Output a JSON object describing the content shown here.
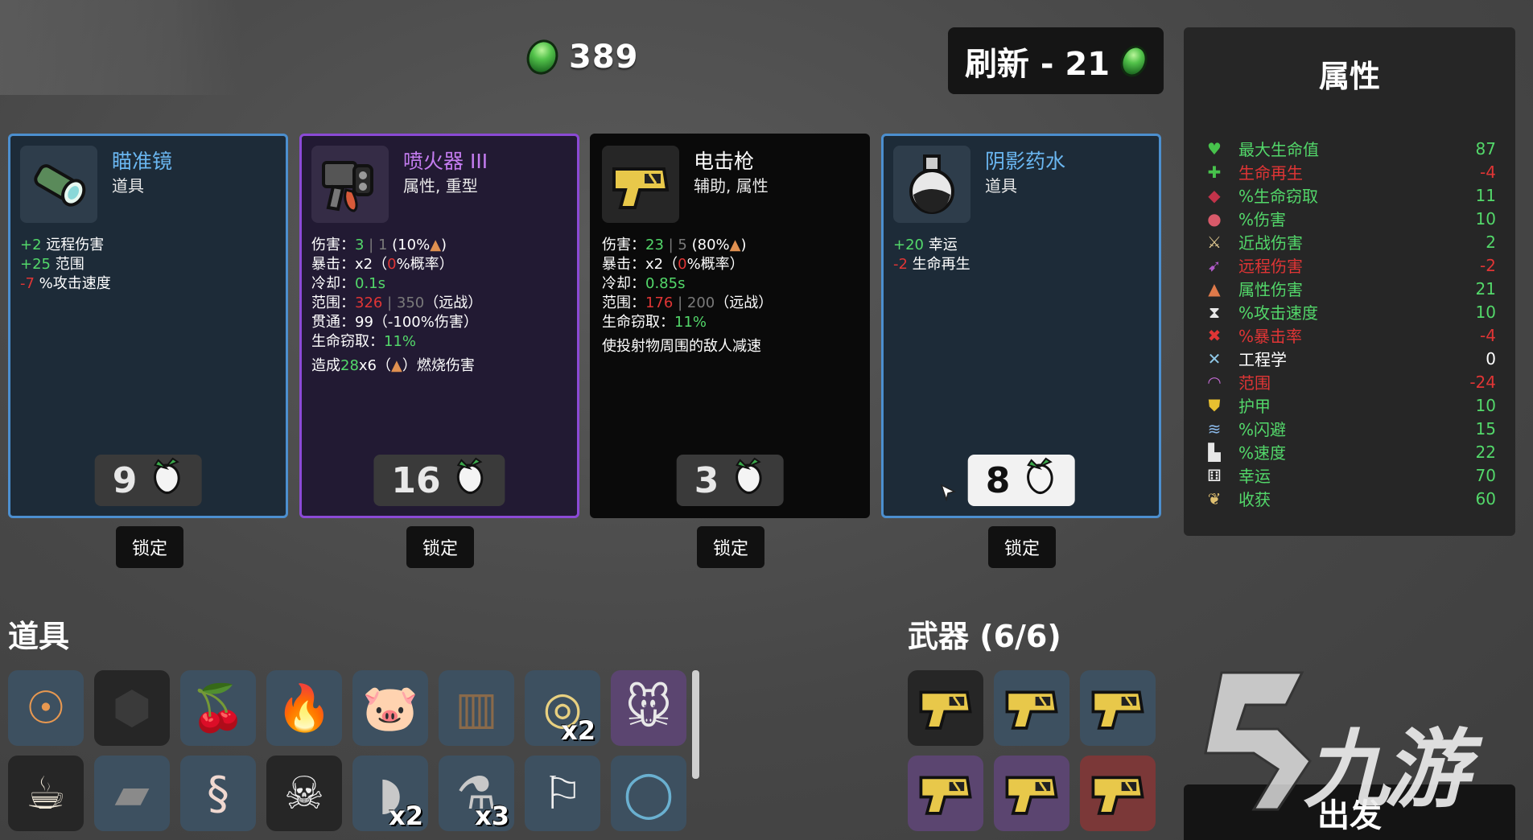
{
  "materials": {
    "count": "389"
  },
  "reroll": {
    "label": "刷新 - 21"
  },
  "shop": {
    "lock_label": "锁定",
    "items": [
      {
        "name": "瞄准镜",
        "tags": "道具",
        "price": "9",
        "icon": "scope-icon",
        "effects": [
          {
            "value": "+2",
            "label": " 远程伤害",
            "color": "g"
          },
          {
            "value": "+25",
            "label": " 范围",
            "color": "g"
          },
          {
            "value": "-7",
            "label": " %攻击速度",
            "color": "r"
          }
        ]
      },
      {
        "name": "喷火器 III",
        "tags": "属性, 重型",
        "price": "16",
        "icon": "flamethrower-icon",
        "stats": [
          {
            "label": "伤害：",
            "main": "3",
            "sep": " | ",
            "base": "1",
            "extra": " (10%",
            "tail": ")"
          },
          {
            "label": "暴击：",
            "main": "x2",
            "extra": "（",
            "red": "0",
            "tail": "%概率）"
          },
          {
            "label": "冷却：",
            "green": "0.1s"
          },
          {
            "label": "范围：",
            "red": "326",
            "sep": " | ",
            "base": "350",
            "tail": "（远战）"
          },
          {
            "label": "贯通：",
            "plain": "99（-100%伤害）"
          },
          {
            "label": "生命窃取：",
            "green": "11%"
          }
        ],
        "burn": {
          "prefix": "造成",
          "dmg": "28",
          "mult": "x6",
          "suffix": "）燃烧伤害"
        }
      },
      {
        "name": "电击枪",
        "tags": "辅助, 属性",
        "price": "3",
        "icon": "taser-icon",
        "stats": [
          {
            "label": "伤害：",
            "main": "23",
            "sep": " | ",
            "base": "5",
            "extra": " (80%",
            "tail": ")"
          },
          {
            "label": "暴击：",
            "main": "x2",
            "extra": "（",
            "red": "0",
            "tail": "%概率）"
          },
          {
            "label": "冷却：",
            "green": "0.85s"
          },
          {
            "label": "范围：",
            "red": "176",
            "sep": " | ",
            "base": "200",
            "tail": "（远战）"
          },
          {
            "label": "生命窃取：",
            "green": "11%"
          }
        ],
        "desc": "使投射物周围的敌人减速"
      },
      {
        "name": "阴影药水",
        "tags": "道具",
        "price": "8",
        "icon": "potion-icon",
        "effects": [
          {
            "value": "+20",
            "label": " 幸运",
            "color": "g"
          },
          {
            "value": "-2",
            "label": " 生命再生",
            "color": "r"
          }
        ]
      }
    ]
  },
  "stats_panel": {
    "title": "属性",
    "rows": [
      {
        "name": "最大生命值",
        "value": "87",
        "tone": "pos",
        "icon": "heart-icon",
        "glyph": "♥",
        "color": "#47c24c"
      },
      {
        "name": "生命再生",
        "value": "-4",
        "tone": "neg",
        "icon": "heart-plus-icon",
        "glyph": "✚",
        "color": "#47c24c"
      },
      {
        "name": "%生命窃取",
        "value": "11",
        "tone": "pos",
        "icon": "fang-icon",
        "glyph": "◆",
        "color": "#c2334a"
      },
      {
        "name": "%伤害",
        "value": "10",
        "tone": "pos",
        "icon": "fist-icon",
        "glyph": "●",
        "color": "#d85a6a"
      },
      {
        "name": "近战伤害",
        "value": "2",
        "tone": "pos",
        "icon": "sword-icon",
        "glyph": "⚔",
        "color": "#e0c890"
      },
      {
        "name": "远程伤害",
        "value": "-2",
        "tone": "neg",
        "icon": "bow-icon",
        "glyph": "➹",
        "color": "#b05ac8"
      },
      {
        "name": "属性伤害",
        "value": "21",
        "tone": "pos",
        "icon": "flame-icon",
        "glyph": "▲",
        "color": "#e07a4a"
      },
      {
        "name": "%攻击速度",
        "value": "10",
        "tone": "pos",
        "icon": "hourglass-icon",
        "glyph": "⧗",
        "color": "#e8e8e8"
      },
      {
        "name": "%暴击率",
        "value": "-4",
        "tone": "neg",
        "icon": "crit-icon",
        "glyph": "✖",
        "color": "#e03535"
      },
      {
        "name": "工程学",
        "value": "0",
        "tone": "zero",
        "icon": "wrench-icon",
        "glyph": "✕",
        "color": "#8fc8e8"
      },
      {
        "name": "范围",
        "value": "-24",
        "tone": "neg",
        "icon": "range-icon",
        "glyph": "◠",
        "color": "#c06ad0"
      },
      {
        "name": "护甲",
        "value": "10",
        "tone": "pos",
        "icon": "shield-icon",
        "glyph": "⛊",
        "color": "#e8c030"
      },
      {
        "name": "%闪避",
        "value": "15",
        "tone": "pos",
        "icon": "dodge-icon",
        "glyph": "≋",
        "color": "#8ab8e8"
      },
      {
        "name": "%速度",
        "value": "22",
        "tone": "pos",
        "icon": "boot-icon",
        "glyph": "▙",
        "color": "#e8e8e8"
      },
      {
        "name": "幸运",
        "value": "70",
        "tone": "pos",
        "icon": "dice-icon",
        "glyph": "⚅",
        "color": "#f0f0f0"
      },
      {
        "name": "收获",
        "value": "60",
        "tone": "pos",
        "icon": "wheat-icon",
        "glyph": "❦",
        "color": "#e0c070"
      }
    ]
  },
  "items_section": {
    "title": "道具",
    "row1": [
      {
        "icon": "angel-icon",
        "bg": "#3d5060",
        "glyph": "☉",
        "color": "#e89850"
      },
      {
        "icon": "rock-icon",
        "bg": "#262626",
        "glyph": "⬢",
        "color": "#3a3a3a"
      },
      {
        "icon": "cherry-knife-icon",
        "bg": "#3d5060",
        "glyph": "🍒",
        "color": "#c83030"
      },
      {
        "icon": "campfire-icon",
        "bg": "#3d5060",
        "glyph": "🔥",
        "color": "#f0a030"
      },
      {
        "icon": "piggy-bank-icon",
        "bg": "#3d5060",
        "glyph": "🐷",
        "color": "#f0a0b0"
      },
      {
        "icon": "bandage-icon",
        "bg": "#3d5060",
        "glyph": "▥",
        "color": "#8a6a4a"
      },
      {
        "icon": "amulet-icon",
        "bg": "#3d5060",
        "glyph": "◎",
        "color": "#e8d080",
        "qty": "x2"
      },
      {
        "icon": "rat-icon",
        "bg": "#5b4570",
        "glyph": "🐭",
        "color": "#e8e8e8"
      }
    ],
    "row2": [
      {
        "icon": "coffee-icon",
        "bg": "#262626",
        "glyph": "☕",
        "color": "#f0e8d8"
      },
      {
        "icon": "bone-icon",
        "bg": "#3d5060",
        "glyph": "▰",
        "color": "#8a8a8a"
      },
      {
        "icon": "worm-icon",
        "bg": "#3d5060",
        "glyph": "§",
        "color": "#f0d8d0"
      },
      {
        "icon": "tooth-icon",
        "bg": "#262626",
        "glyph": "☠",
        "color": "#f0f0f0"
      },
      {
        "icon": "horn-icon",
        "bg": "#3d5060",
        "glyph": "◗",
        "color": "#c8c8c8",
        "qty": "x2"
      },
      {
        "icon": "flask-icon",
        "bg": "#3d5060",
        "glyph": "⚗",
        "color": "#c8c8c8",
        "qty": "x3"
      },
      {
        "icon": "flag-icon",
        "bg": "#3d5060",
        "glyph": "⚐",
        "color": "#f0f0f0"
      },
      {
        "icon": "ring-icon",
        "bg": "#3d5060",
        "glyph": "◯",
        "color": "#6ab0d0"
      }
    ]
  },
  "weapons_section": {
    "title": "武器 (6/6)",
    "slots": [
      {
        "bg": "#262626"
      },
      {
        "bg": "#3d5060"
      },
      {
        "bg": "#3d5060"
      },
      {
        "bg": "#5b4570"
      },
      {
        "bg": "#5b4570"
      },
      {
        "bg": "#7b3838"
      }
    ]
  },
  "go_button": {
    "label": "出发"
  },
  "watermark": {
    "text": "九游"
  }
}
